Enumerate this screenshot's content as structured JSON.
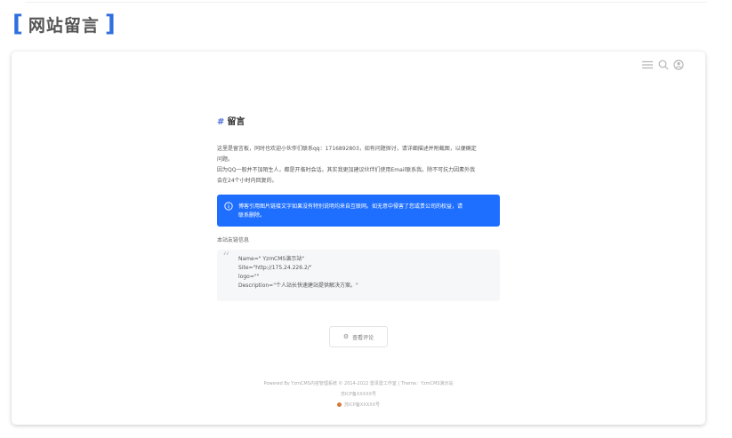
{
  "section": {
    "bracket_open": "[",
    "title": "网站留言",
    "bracket_close": "]"
  },
  "nav": {
    "icons": [
      "menu-icon",
      "search-icon",
      "user-icon"
    ]
  },
  "post": {
    "hash": "#",
    "title": "留言",
    "paragraph_line1": "这里是留言板，同时也欢迎小伙伴们联系qq：1716892803，如有问题探讨，请详细描述并附截图，以便确定",
    "paragraph_line2": "问题。",
    "paragraph_line3": "因为QQ一般并不加陌生人，都是开临时会话。其实我更加建议伙伴们使用Email联系我。除不可抗力因素外我",
    "paragraph_line4": "会在24个小时内回复的。"
  },
  "notice": {
    "text_line1": "博客引用图片链接文字如果没有特别说明均来自互联网。如无意中侵害了您或贵公司的权益，请",
    "text_line2": "联系删除。",
    "accent": "#1e6fff"
  },
  "links": {
    "title": "本站友链信息",
    "quote_mark": "“",
    "lines": [
      "Name=\" YzmCMS演示站\"",
      "Site=\"http://175.24.226.2/\"",
      "logo=\"\"",
      "Description=\"个人站长快速建站提供解决方案。\""
    ]
  },
  "comments": {
    "gear": "⚙",
    "label": "查看评论"
  },
  "footer": {
    "powered": "Powered By YzmCMS内容管理系统 © 2014-2022 雷泽雷工作室 | Theme：YzmCMS演示站",
    "icp": "苏ICP备XXXXX号",
    "police": "苏ICP备XXXXX号"
  }
}
